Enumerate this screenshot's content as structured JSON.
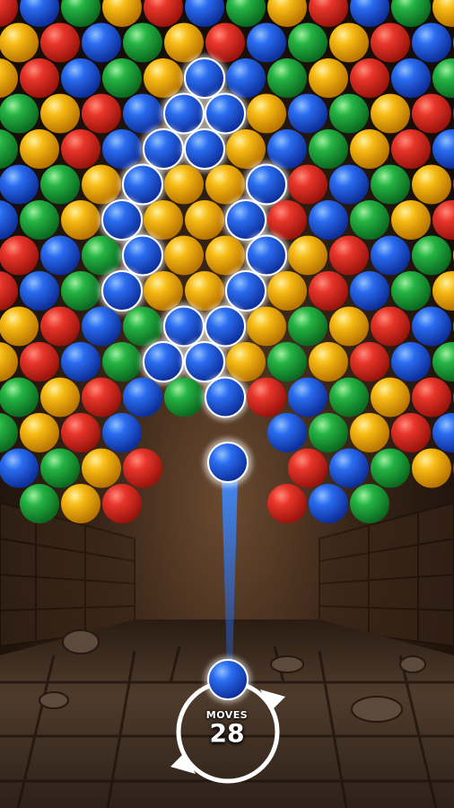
{
  "hud": {
    "moves_label": "MOVES",
    "moves_value": "28"
  },
  "palette": {
    "red": "#d92a1e",
    "blue": "#1f5fe0",
    "green": "#1fa83a",
    "yellow": "#f2b10c",
    "glow": "#ffffff",
    "aim": "#2e7bff",
    "wall": "#3a2618",
    "floor": "#4a3a2e"
  },
  "shooter": {
    "current_ball": "blue",
    "next_ball": "blue"
  }
}
